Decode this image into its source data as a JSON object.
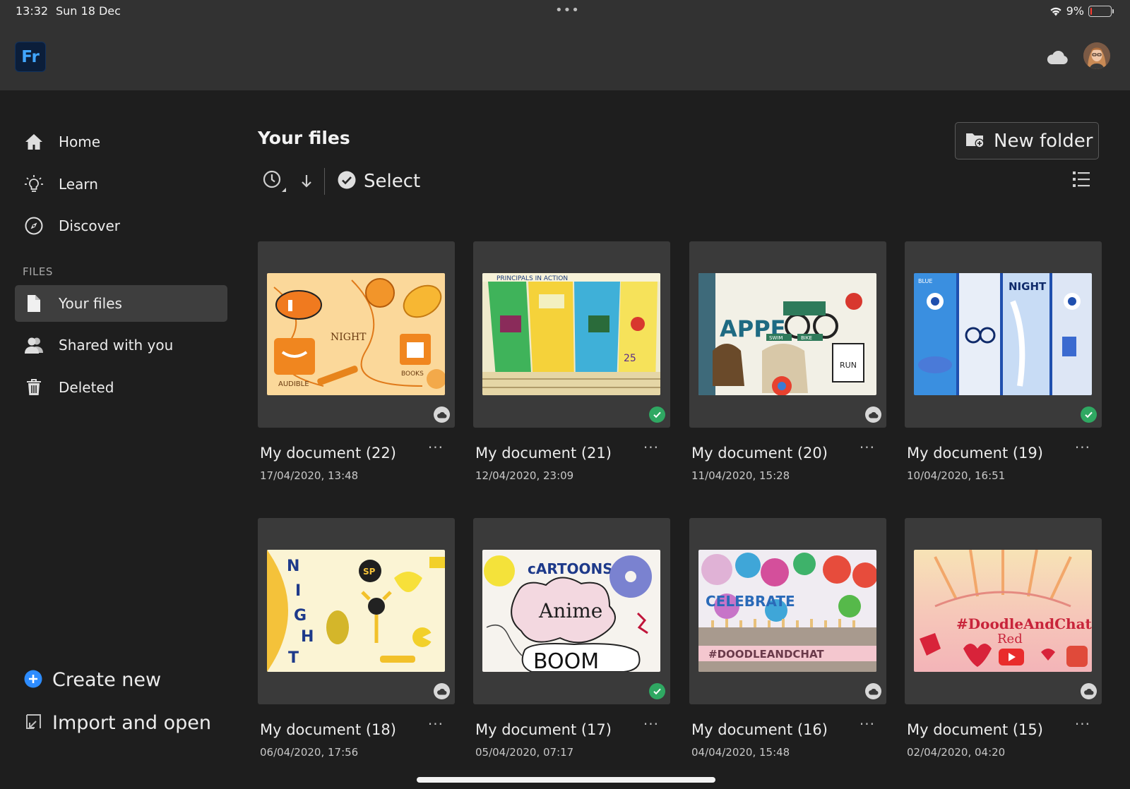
{
  "status_bar": {
    "time": "13:32",
    "date": "Sun 18 Dec",
    "battery": "9%",
    "battery_level": 0.09,
    "multitask": "•••"
  },
  "header": {
    "logo": "Fr",
    "logo_color": "#41a6ff",
    "cloud_icon": "cloud-icon"
  },
  "sidebar": {
    "items": [
      {
        "label": "Home",
        "icon": "home-icon"
      },
      {
        "label": "Learn",
        "icon": "lightbulb-icon"
      },
      {
        "label": "Discover",
        "icon": "compass-icon"
      }
    ],
    "section_label": "FILES",
    "file_items": [
      {
        "label": "Your files",
        "icon": "document-icon",
        "active": true
      },
      {
        "label": "Shared with you",
        "icon": "people-icon"
      },
      {
        "label": "Deleted",
        "icon": "trash-icon"
      }
    ],
    "create_new": "Create new",
    "import_open": "Import and open",
    "accent": "#2d8cff"
  },
  "main": {
    "title": "Your files",
    "new_folder": "New folder",
    "select": "Select",
    "more": "···",
    "files": [
      {
        "name": "My document (22)",
        "date": "17/04/2020, 13:48",
        "status": "cloud"
      },
      {
        "name": "My document (21)",
        "date": "12/04/2020, 23:09",
        "status": "synced"
      },
      {
        "name": "My document (20)",
        "date": "11/04/2020, 15:28",
        "status": "cloud"
      },
      {
        "name": "My document (19)",
        "date": "10/04/2020, 16:51",
        "status": "synced"
      },
      {
        "name": "My document (18)",
        "date": "06/04/2020, 17:56",
        "status": "cloud"
      },
      {
        "name": "My document (17)",
        "date": "05/04/2020, 07:17",
        "status": "synced"
      },
      {
        "name": "My document (16)",
        "date": "04/04/2020, 15:48",
        "status": "cloud"
      },
      {
        "name": "My document (15)",
        "date": "02/04/2020, 04:20",
        "status": "cloud"
      }
    ]
  }
}
